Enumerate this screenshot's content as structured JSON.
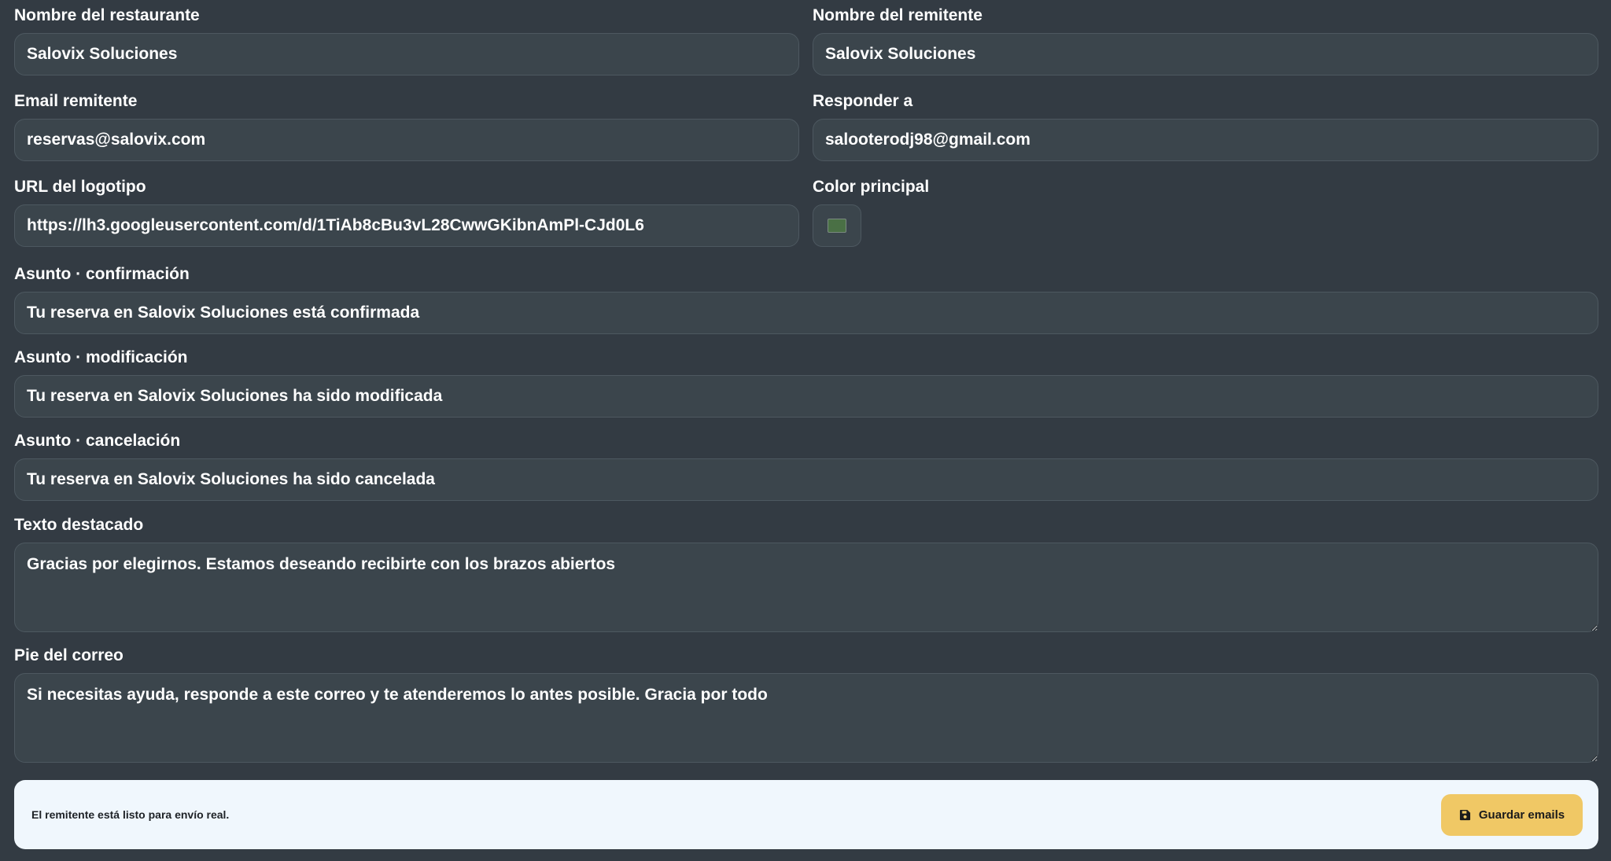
{
  "form": {
    "restaurant_name": {
      "label": "Nombre del restaurante",
      "value": "Salovix Soluciones"
    },
    "sender_name": {
      "label": "Nombre del remitente",
      "value": "Salovix Soluciones"
    },
    "sender_email": {
      "label": "Email remitente",
      "value": "reservas@salovix.com"
    },
    "reply_to": {
      "label": "Responder a",
      "value": "salooterodj98@gmail.com"
    },
    "logo_url": {
      "label": "URL del logotipo",
      "value": "https://lh3.googleusercontent.com/d/1TiAb8cBu3vL28CwwGKibnAmPl-CJd0L6"
    },
    "main_color": {
      "label": "Color principal",
      "value": "#4a7045"
    },
    "subject_confirmation": {
      "label": "Asunto · confirmación",
      "value": "Tu reserva en Salovix Soluciones está confirmada"
    },
    "subject_modification": {
      "label": "Asunto · modificación",
      "value": "Tu reserva en Salovix Soluciones ha sido modificada"
    },
    "subject_cancellation": {
      "label": "Asunto · cancelación",
      "value": "Tu reserva en Salovix Soluciones ha sido cancelada"
    },
    "highlight_text": {
      "label": "Texto destacado",
      "value": "Gracias por elegirnos. Estamos deseando recibirte con los brazos abiertos"
    },
    "email_footer": {
      "label": "Pie del correo",
      "value": "Si necesitas ayuda, responde a este correo y te atenderemos lo antes posible. Gracia por todo"
    }
  },
  "footer": {
    "status": "El remitente está listo para envío real.",
    "save_label": "Guardar emails",
    "save_icon": "floppy-disk-icon"
  },
  "colors": {
    "background": "#333b43",
    "input_bg": "#3b454c",
    "footer_bg": "#f0f7fd",
    "accent": "#f0c865"
  }
}
